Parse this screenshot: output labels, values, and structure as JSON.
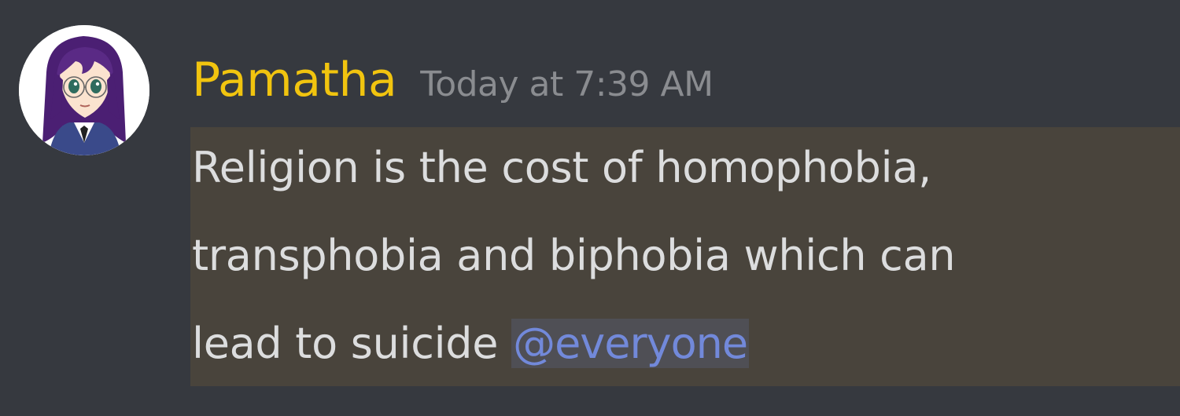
{
  "message": {
    "author": {
      "name": "Pamatha",
      "avatar_icon": "anime-girl-avatar-icon",
      "name_color": "#f1c40f"
    },
    "timestamp": "Today at 7:39 AM",
    "content_lines": [
      "Religion is the cost of homophobia,",
      "transphobia and biphobia which can",
      "lead to suicide "
    ],
    "mention": "@everyone",
    "mention_color": "#7289da",
    "highlight_color": "#49443c"
  }
}
